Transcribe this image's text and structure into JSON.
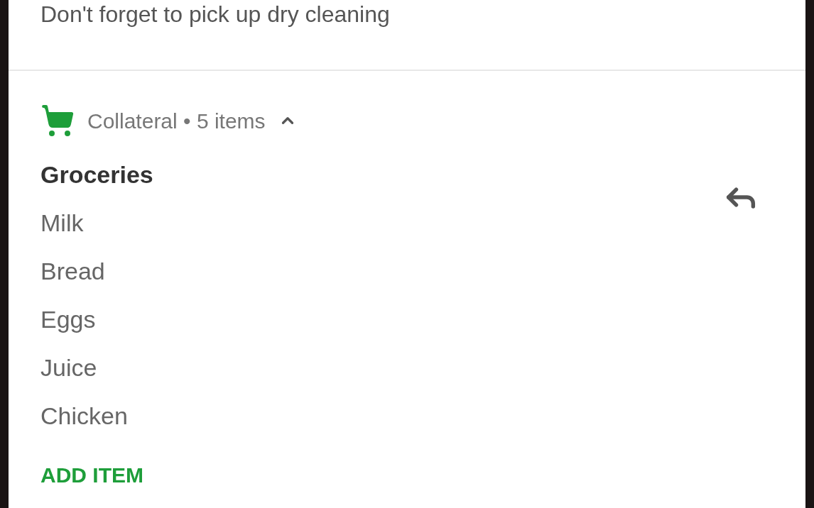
{
  "note": "Don't forget to pick up dry cleaning",
  "header": {
    "text": "Collateral • 5 items",
    "expanded": true
  },
  "list": {
    "title": "Groceries",
    "items": [
      "Milk",
      "Bread",
      "Eggs",
      "Juice",
      "Chicken"
    ]
  },
  "action": "ADD ITEM"
}
